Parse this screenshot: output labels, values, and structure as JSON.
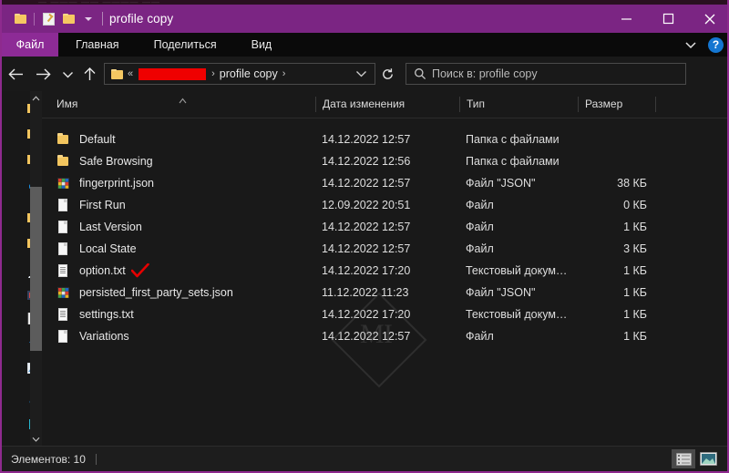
{
  "window": {
    "title": "profile copy",
    "accent_purple": "#7b2583",
    "background": "#191919",
    "redaction_color": "#ef0000",
    "quick_access": [
      {
        "name": "folder-icon",
        "label": "Folder"
      },
      {
        "name": "properties-icon",
        "label": "Properties"
      },
      {
        "name": "new-folder-icon",
        "label": "New folder"
      },
      {
        "name": "chevron-down-icon",
        "label": "Customize Quick Access Toolbar"
      }
    ],
    "controls": {
      "minimize": "—",
      "maximize": "□",
      "close": "✕"
    }
  },
  "bg_window_strip": "— ———  —— ————  ——",
  "ribbon": {
    "tabs": [
      {
        "label": "Файл",
        "active": true
      },
      {
        "label": "Главная",
        "active": false
      },
      {
        "label": "Поделиться",
        "active": false
      },
      {
        "label": "Вид",
        "active": false
      }
    ],
    "expand_icon": "chevron-down-icon",
    "help_label": "?"
  },
  "toolbar": {
    "back_icon": "arrow-left-icon",
    "forward_icon": "arrow-right-icon",
    "recent_icon": "chevron-down-icon",
    "up_icon": "arrow-up-icon",
    "refresh_icon": "refresh-icon"
  },
  "address": {
    "root_sep": "«",
    "redacted_segment": "",
    "crumb": "profile copy",
    "sep": "›",
    "dropdown_icon": "chevron-down-icon"
  },
  "search": {
    "icon": "search-icon",
    "placeholder": "Поиск в: profile copy",
    "value": ""
  },
  "nav_pane": {
    "items": [
      {
        "name": "nav-folder-1",
        "icon": "folder-icon"
      },
      {
        "name": "nav-folder-2",
        "icon": "folder-icon"
      },
      {
        "name": "nav-folder-3",
        "icon": "folder-icon"
      },
      {
        "name": "nav-onedrive",
        "icon": "cloud-icon"
      },
      {
        "name": "nav-folder-4",
        "icon": "folder-icon"
      },
      {
        "name": "nav-folder-5",
        "icon": "folder-icon"
      },
      {
        "name": "nav-this-pc",
        "icon": "computer-icon"
      },
      {
        "name": "nav-videos",
        "icon": "video-icon"
      },
      {
        "name": "nav-documents",
        "icon": "documents-icon"
      },
      {
        "name": "nav-downloads",
        "icon": "download-icon"
      },
      {
        "name": "nav-pictures",
        "icon": "pictures-icon"
      },
      {
        "name": "nav-music",
        "icon": "music-icon"
      },
      {
        "name": "nav-desktop",
        "icon": "desktop-icon"
      },
      {
        "name": "nav-local-disk",
        "icon": "drive-icon"
      }
    ],
    "scroll_up_icon": "chevron-up-icon",
    "scroll_down_icon": "chevron-down-icon"
  },
  "columns": {
    "name": "Имя",
    "date": "Дата изменения",
    "type": "Тип",
    "size": "Размер",
    "sort_indicator": "sort-ascending-icon"
  },
  "files": [
    {
      "name": "Default",
      "icon": "folder-icon",
      "date": "14.12.2022 12:57",
      "type": "Папка с файлами",
      "size": "",
      "marked": false
    },
    {
      "name": "Safe Browsing",
      "icon": "folder-icon",
      "date": "14.12.2022 12:56",
      "type": "Папка с файлами",
      "size": "",
      "marked": false
    },
    {
      "name": "fingerprint.json",
      "icon": "json-file-icon",
      "date": "14.12.2022 12:57",
      "type": "Файл \"JSON\"",
      "size": "38 КБ",
      "marked": false
    },
    {
      "name": "First Run",
      "icon": "blank-file-icon",
      "date": "12.09.2022 20:51",
      "type": "Файл",
      "size": "0 КБ",
      "marked": false
    },
    {
      "name": "Last Version",
      "icon": "blank-file-icon",
      "date": "14.12.2022 12:57",
      "type": "Файл",
      "size": "1 КБ",
      "marked": false
    },
    {
      "name": "Local State",
      "icon": "blank-file-icon",
      "date": "14.12.2022 12:57",
      "type": "Файл",
      "size": "3 КБ",
      "marked": false
    },
    {
      "name": "option.txt",
      "icon": "text-file-icon",
      "date": "14.12.2022 17:20",
      "type": "Текстовый докум…",
      "size": "1 КБ",
      "marked": true
    },
    {
      "name": "persisted_first_party_sets.json",
      "icon": "json-file-icon",
      "date": "11.12.2022 11:23",
      "type": "Файл \"JSON\"",
      "size": "1 КБ",
      "marked": false
    },
    {
      "name": "settings.txt",
      "icon": "text-file-icon",
      "date": "14.12.2022 17:20",
      "type": "Текстовый докум…",
      "size": "1 КБ",
      "marked": false
    },
    {
      "name": "Variations",
      "icon": "blank-file-icon",
      "date": "14.12.2022 12:57",
      "type": "Файл",
      "size": "1 КБ",
      "marked": false
    }
  ],
  "status": {
    "item_count_text": "Элементов: 10",
    "details_view_icon": "details-view-icon",
    "large_icons_view_icon": "large-icons-view-icon"
  },
  "watermark": {
    "text": "M"
  }
}
